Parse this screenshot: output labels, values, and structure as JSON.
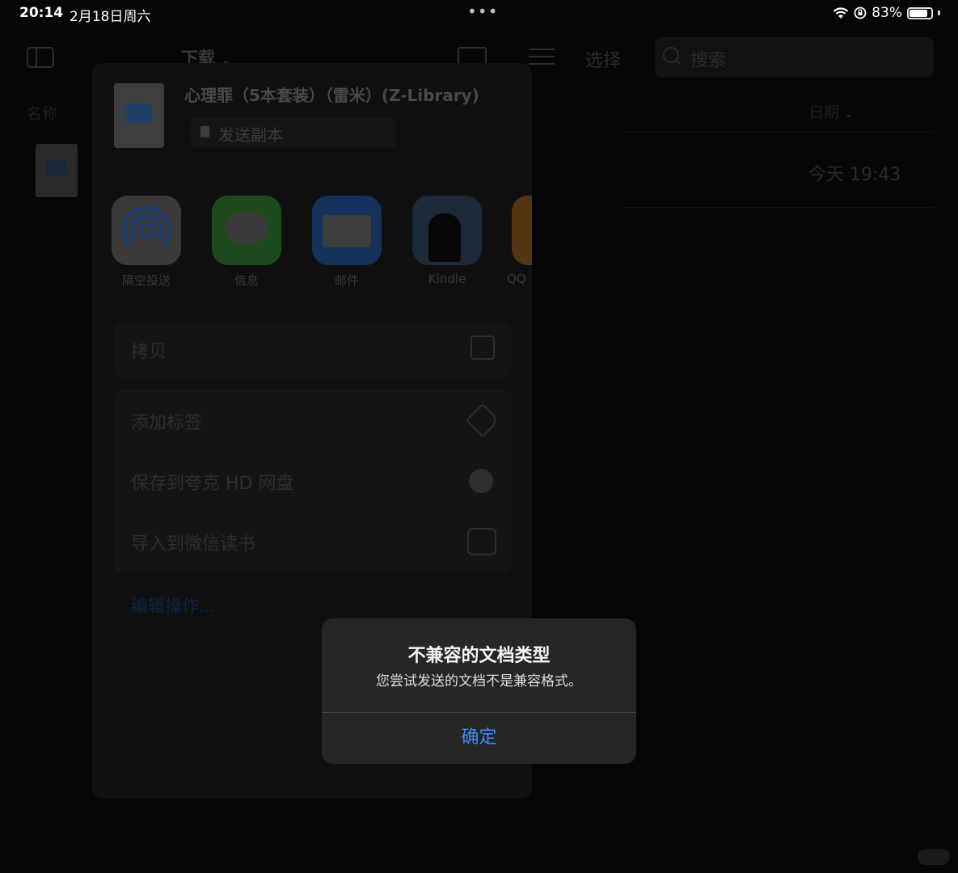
{
  "status_bar": {
    "time": "20:14",
    "date": "2月18日周六",
    "dots": "•••",
    "battery_percent": "83%",
    "battery_level": 0.83
  },
  "files_app": {
    "location_title": "下载",
    "select_label": "选择",
    "search_placeholder": "搜索",
    "column_name": "名称",
    "column_date": "日期",
    "file_date": "今天 19:43"
  },
  "share_sheet": {
    "document_title": "心理罪（5本套装）（雷米）(Z-Library)",
    "send_copy_label": "发送副本",
    "apps": [
      {
        "label": "隔空投送",
        "icon": "airdrop-icon"
      },
      {
        "label": "信息",
        "icon": "messages-icon"
      },
      {
        "label": "邮件",
        "icon": "mail-icon"
      },
      {
        "label": "Kindle",
        "icon": "kindle-icon"
      },
      {
        "label": "QQ",
        "icon": "qq-icon"
      }
    ],
    "actions_group1": [
      {
        "label": "拷贝",
        "icon": "copy-icon"
      }
    ],
    "actions_group2": [
      {
        "label": "添加标签",
        "icon": "tag-icon"
      },
      {
        "label": "保存到夸克 HD 网盘",
        "icon": "quark-icon"
      },
      {
        "label": "导入到微信读书",
        "icon": "weread-icon"
      }
    ],
    "edit_actions_label": "编辑操作..."
  },
  "alert": {
    "title": "不兼容的文档类型",
    "message": "您尝试发送的文档不是兼容格式。",
    "ok_label": "确定"
  },
  "colors": {
    "alert_button": "#3d8bff",
    "alert_bg": "#262626"
  }
}
